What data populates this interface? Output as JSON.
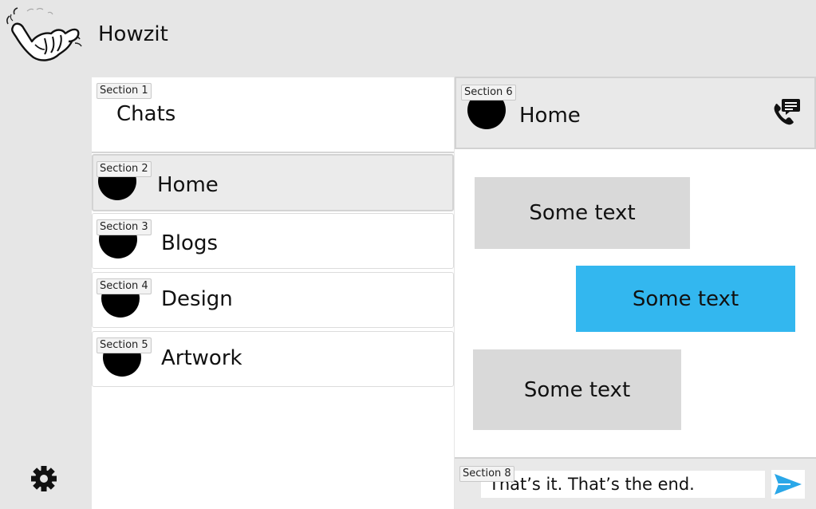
{
  "app": {
    "title": "Howzit"
  },
  "sections": {
    "s1": "Section 1",
    "s2": "Section 2",
    "s3": "Section 3",
    "s4": "Section 4",
    "s5": "Section 5",
    "s6": "Section 6",
    "s8": "Section 8"
  },
  "chat_list": {
    "title": "Chats",
    "items": [
      {
        "name": "Home",
        "active": true
      },
      {
        "name": "Blogs",
        "active": false
      },
      {
        "name": "Design",
        "active": false
      },
      {
        "name": "Artwork",
        "active": false
      }
    ]
  },
  "conversation": {
    "title": "Home",
    "messages": [
      {
        "text": "Some text",
        "direction": "incoming"
      },
      {
        "text": "Some text",
        "direction": "outgoing"
      },
      {
        "text": "Some text",
        "direction": "incoming"
      }
    ],
    "compose_value": "That’s it. That’s the end."
  },
  "icons": {
    "logo": "shaka-hand-icon",
    "call": "phone-chat-icon",
    "send": "send-icon",
    "settings": "gear-icon"
  },
  "colors": {
    "background": "#e6e6e6",
    "outgoing_bubble": "#33b7ef",
    "incoming_bubble": "#d9d9d9",
    "send_icon": "#2aa7e8"
  }
}
